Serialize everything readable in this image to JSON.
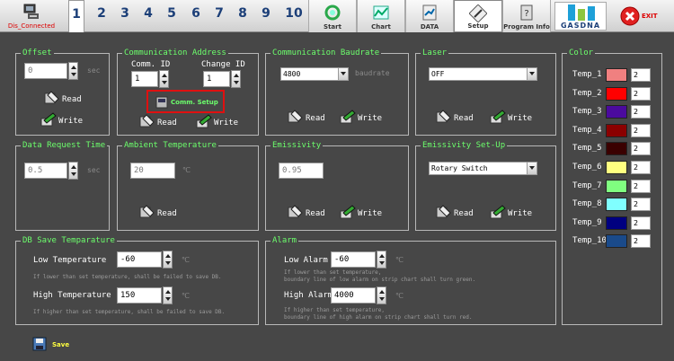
{
  "topbar": {
    "connection_label": "Dis_Connected",
    "numbers": [
      "1",
      "2",
      "3",
      "4",
      "5",
      "6",
      "7",
      "8",
      "9",
      "10"
    ],
    "tabs": {
      "start": "Start",
      "chart": "Chart",
      "data": "DATA",
      "setup": "Setup",
      "program_info": "Program Info"
    },
    "logo": "GASDNA",
    "exit": "EXIT"
  },
  "offset": {
    "title": "Offset",
    "value": "0",
    "unit": "sec",
    "read": "Read",
    "write": "Write"
  },
  "comm": {
    "title": "Communication Address",
    "comm_id_label": "Comm. ID",
    "comm_id": "1",
    "change_id_label": "Change ID",
    "change_id": "1",
    "setup_btn": "Comm. Setup",
    "read": "Read",
    "write": "Write"
  },
  "baud": {
    "title": "Communication Baudrate",
    "value": "4800",
    "unit": "baudrate",
    "read": "Read",
    "write": "Write"
  },
  "laser": {
    "title": "Laser",
    "value": "OFF",
    "read": "Read",
    "write": "Write"
  },
  "datareq": {
    "title": "Data Request Time",
    "value": "0.5",
    "unit": "sec"
  },
  "ambient": {
    "title": "Ambient Temperature",
    "value": "20",
    "unit": "℃",
    "read": "Read"
  },
  "emis": {
    "title": "Emissivity",
    "value": "0.95",
    "read": "Read",
    "write": "Write"
  },
  "emisset": {
    "title": "Emissivity Set-Up",
    "value": "Rotary Switch",
    "read": "Read",
    "write": "Write"
  },
  "dbsave": {
    "title": "DB Save Temparature",
    "low_label": "Low Temperature",
    "low": "-60",
    "low_hint": "If lower than set temperature, shall be failed to save DB.",
    "high_label": "High Temperature",
    "high": "150",
    "high_hint": "If higher than set temperature, shall be failed to save DB.",
    "unit": "℃"
  },
  "alarm": {
    "title": "Alarm",
    "low_label": "Low Alarm",
    "low": "-60",
    "low_hint1": "If lower than set temperature,",
    "low_hint2": "boundary line of low alarm on strip chart shall turn green.",
    "high_label": "High Alarm",
    "high": "4000",
    "high_hint1": "If higher than set temperature,",
    "high_hint2": "boundary line of high alarm on strip chart shall turn red.",
    "unit": "℃"
  },
  "color": {
    "title": "Color",
    "items": [
      {
        "label": "Temp_1",
        "color": "#f08080",
        "value": "2"
      },
      {
        "label": "Temp_2",
        "color": "#ff0000",
        "value": "2"
      },
      {
        "label": "Temp_3",
        "color": "#4b0a9e",
        "value": "2"
      },
      {
        "label": "Temp_4",
        "color": "#8b0000",
        "value": "2"
      },
      {
        "label": "Temp_5",
        "color": "#3a0000",
        "value": "2"
      },
      {
        "label": "Temp_6",
        "color": "#ffff80",
        "value": "2"
      },
      {
        "label": "Temp_7",
        "color": "#80ff80",
        "value": "2"
      },
      {
        "label": "Temp_8",
        "color": "#80ffff",
        "value": "2"
      },
      {
        "label": "Temp_9",
        "color": "#000080",
        "value": "2"
      },
      {
        "label": "Temp_10",
        "color": "#1a4a8a",
        "value": "2"
      }
    ]
  },
  "save": "Save"
}
